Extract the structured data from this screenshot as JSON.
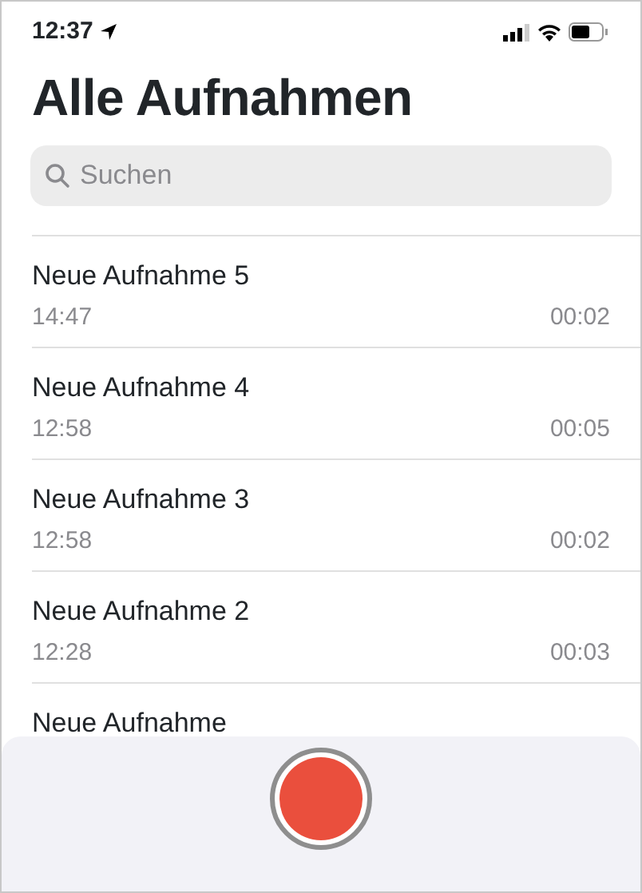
{
  "status_bar": {
    "time": "12:37"
  },
  "title": "Alle Aufnahmen",
  "search": {
    "placeholder": "Suchen"
  },
  "recordings": [
    {
      "name": "Neue Aufnahme 5",
      "date": "14:47",
      "duration": "00:02"
    },
    {
      "name": "Neue Aufnahme 4",
      "date": "12:58",
      "duration": "00:05"
    },
    {
      "name": "Neue Aufnahme 3",
      "date": "12:58",
      "duration": "00:02"
    },
    {
      "name": "Neue Aufnahme 2",
      "date": "12:28",
      "duration": "00:03"
    },
    {
      "name": "Neue Aufnahme"
    }
  ]
}
